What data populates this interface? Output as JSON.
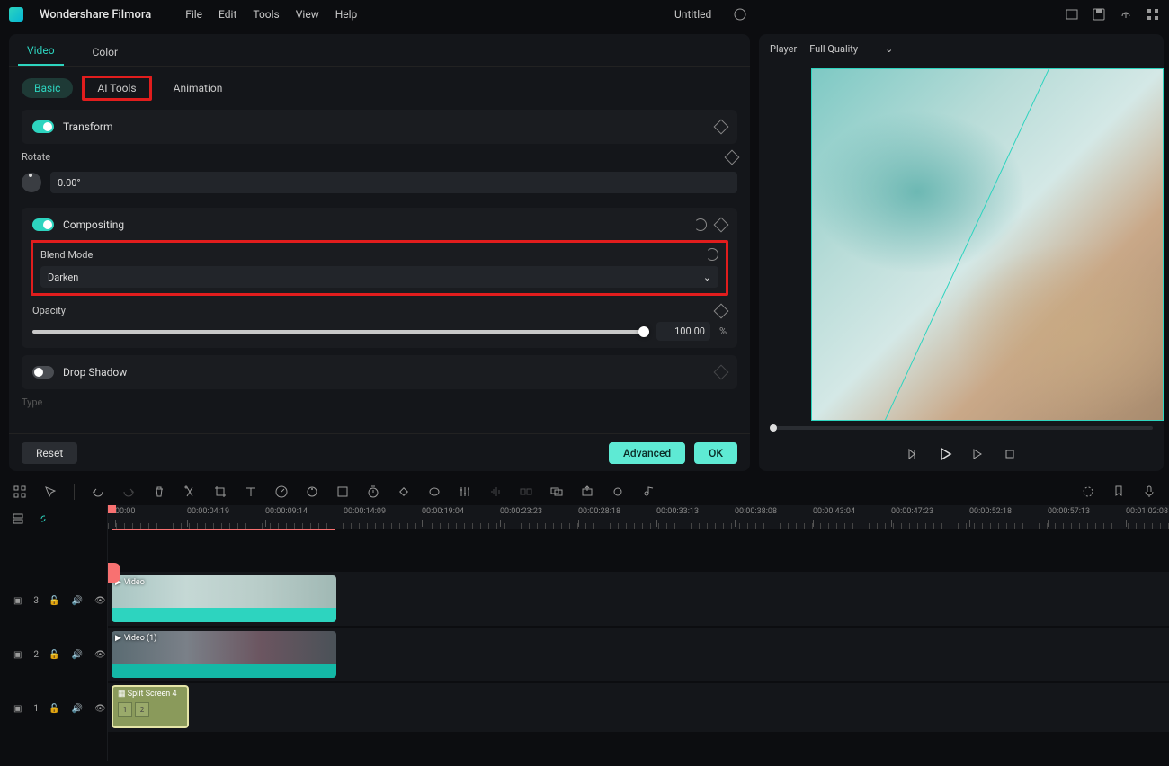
{
  "menubar": {
    "app_name": "Wondershare Filmora",
    "items": [
      "File",
      "Edit",
      "Tools",
      "View",
      "Help"
    ],
    "doc_title": "Untitled"
  },
  "props": {
    "top_tabs": {
      "video": "Video",
      "color": "Color"
    },
    "sub_tabs": {
      "basic": "Basic",
      "ai": "AI Tools",
      "anim": "Animation"
    },
    "transform": {
      "label": "Transform",
      "rotate_label": "Rotate",
      "rotate_value": "0.00°"
    },
    "compositing": {
      "label": "Compositing",
      "blend_label": "Blend Mode",
      "blend_value": "Darken",
      "opacity_label": "Opacity",
      "opacity_value": "100.00",
      "opacity_unit": "%"
    },
    "dropshadow": {
      "label": "Drop Shadow",
      "type_label": "Type"
    },
    "footer": {
      "reset": "Reset",
      "advanced": "Advanced",
      "ok": "OK"
    }
  },
  "preview": {
    "player_label": "Player",
    "quality": "Full Quality"
  },
  "timeline": {
    "ticks": [
      "00:00",
      "00:00:04:19",
      "00:00:09:14",
      "00:00:14:09",
      "00:00:19:04",
      "00:00:23:23",
      "00:00:28:18",
      "00:00:33:13",
      "00:00:38:08",
      "00:00:43:04",
      "00:00:47:23",
      "00:00:52:18",
      "00:00:57:13",
      "00:01:02:08"
    ],
    "track3": {
      "label": "3",
      "clip": "Video"
    },
    "track2": {
      "label": "2",
      "clip": "Video (1)"
    },
    "track1": {
      "label": "1",
      "clip": "Split Screen 4",
      "box1": "1",
      "box2": "2"
    }
  }
}
